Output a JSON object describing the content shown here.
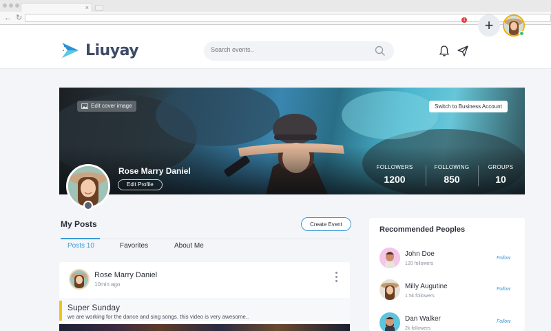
{
  "app": {
    "brand": "Liuyay",
    "brand_color": "#3d4a66",
    "accent_color": "#3b9bd6"
  },
  "search": {
    "placeholder": "Search events.."
  },
  "header": {
    "notification_badge": "1",
    "icons": [
      "bell-icon",
      "paper-plane-icon",
      "plus-icon"
    ],
    "add_label": "+"
  },
  "cover": {
    "edit_cover_label": "Edit cover image",
    "switch_account_label": "Switch to Business Account"
  },
  "profile": {
    "name": "Rose Marry Daniel",
    "edit_label": "Edit Profile",
    "stats": [
      {
        "label": "FOLLOWERS",
        "value": "1200"
      },
      {
        "label": "FOLLOWING",
        "value": "850"
      },
      {
        "label": "GROUPS",
        "value": "10"
      }
    ]
  },
  "posts": {
    "heading": "My Posts",
    "create_event_label": "Create Event",
    "tabs": [
      {
        "label": "Posts 10",
        "active": true
      },
      {
        "label": "Favorites",
        "active": false
      },
      {
        "label": "About Me",
        "active": false
      }
    ],
    "items": [
      {
        "author": "Rose Marry Daniel",
        "time": "10min ago",
        "title": "Super Sunday",
        "description": "we are working for the dance and sing songs. this video is very awesome.."
      }
    ]
  },
  "recommended": {
    "heading": "Recommended Peoples",
    "people": [
      {
        "name": "John Doe",
        "followers": "120 followers",
        "action": "Follow"
      },
      {
        "name": "Milly Augutine",
        "followers": "1.5k followers",
        "action": "Follow"
      },
      {
        "name": "Dan Walker",
        "followers": "2k followers",
        "action": "Follow"
      }
    ]
  }
}
